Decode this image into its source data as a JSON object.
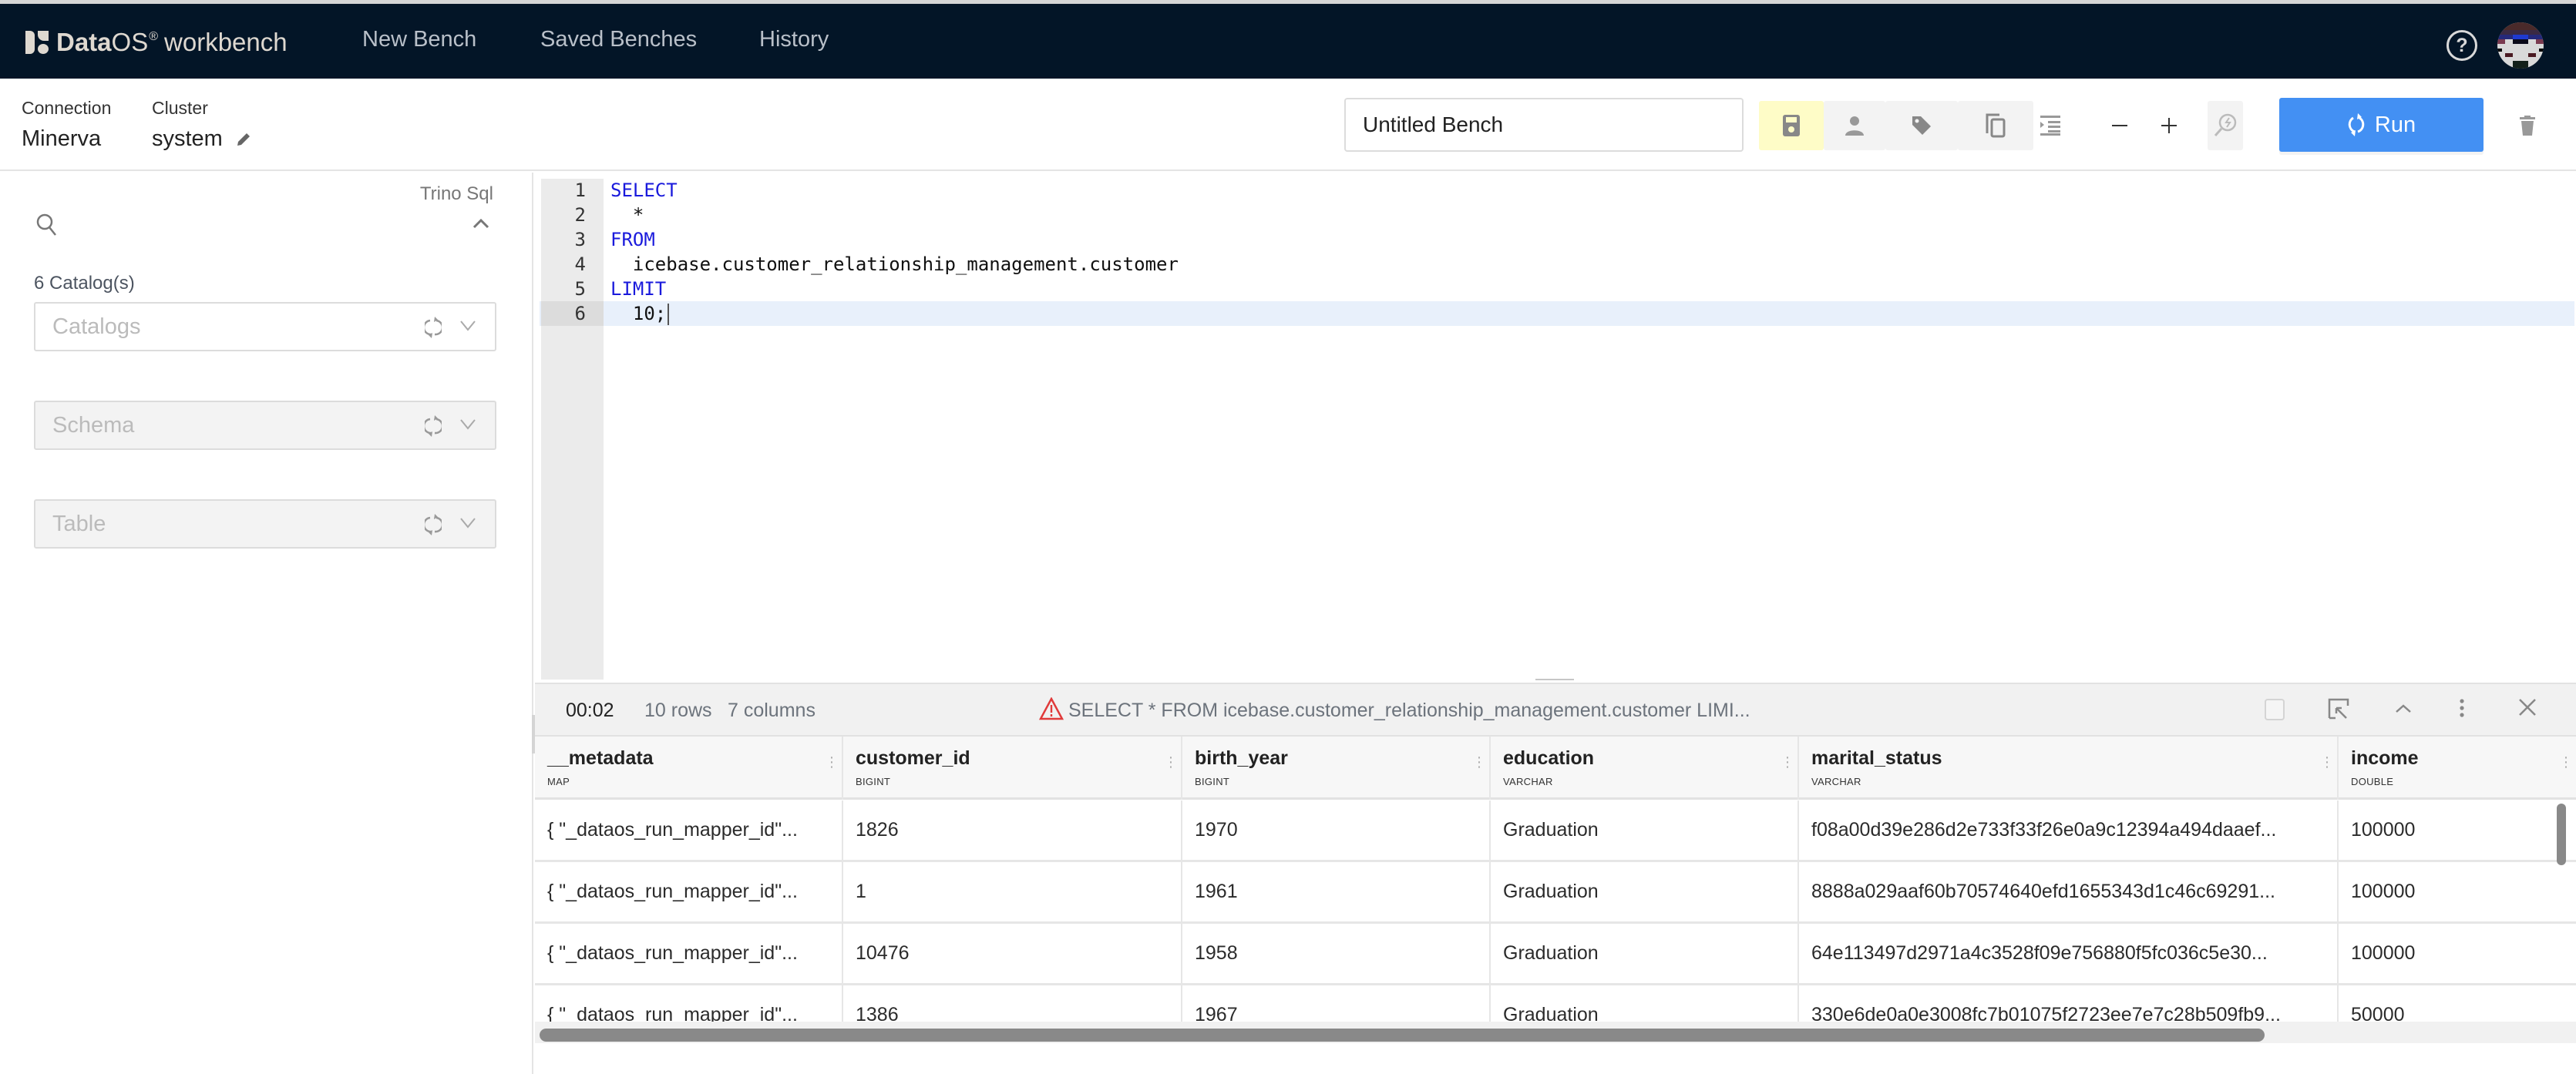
{
  "app": {
    "brand_bold": "Data",
    "brand_regular": "OS",
    "brand_reg_mark": "®",
    "brand_product": "workbench"
  },
  "nav": {
    "items": [
      {
        "label": "New Bench"
      },
      {
        "label": "Saved Benches"
      },
      {
        "label": "History"
      }
    ],
    "help_label": "?"
  },
  "connection": {
    "connection_label": "Connection",
    "connection_value": "Minerva",
    "cluster_label": "Cluster",
    "cluster_value": "system"
  },
  "toolbar": {
    "bench_name": "Untitled Bench",
    "bench_name_placeholder": "Untitled Bench",
    "icons": [
      "save-icon",
      "user-icon",
      "tag-icon",
      "copy-icon",
      "indent-icon",
      "zoom-out-icon",
      "zoom-in-icon",
      "analyze-icon",
      "delete-icon"
    ],
    "run_label": "Run",
    "colors": {
      "run": "#4390f3",
      "save_bg": "#fefcc7",
      "nav_bg": "#031527"
    }
  },
  "sidebar": {
    "language": "Trino Sql",
    "catalog_count": "6 Catalog(s)",
    "selects": [
      {
        "placeholder": "Catalogs",
        "disabled": false
      },
      {
        "placeholder": "Schema",
        "disabled": true
      },
      {
        "placeholder": "Table",
        "disabled": true
      }
    ]
  },
  "editor": {
    "lines": [
      {
        "num": "1",
        "text": "SELECT",
        "keyword": true
      },
      {
        "num": "2",
        "text": "  *",
        "keyword": false
      },
      {
        "num": "3",
        "text": "FROM",
        "keyword": true
      },
      {
        "num": "4",
        "text": "  icebase.customer_relationship_management.customer",
        "keyword": false
      },
      {
        "num": "5",
        "text": "LIMIT",
        "keyword": true
      },
      {
        "num": "6",
        "text": "  10;",
        "keyword": false
      }
    ],
    "active_line": 6
  },
  "results": {
    "elapsed": "00:02",
    "rows": "10 rows",
    "columns_count": "7 columns",
    "query_preview": "SELECT * FROM icebase.customer_relationship_management.customer LIMI...",
    "columns": [
      {
        "name": "__metadata",
        "type": "MAP"
      },
      {
        "name": "customer_id",
        "type": "BIGINT"
      },
      {
        "name": "birth_year",
        "type": "BIGINT"
      },
      {
        "name": "education",
        "type": "VARCHAR"
      },
      {
        "name": "marital_status",
        "type": "VARCHAR"
      },
      {
        "name": "income",
        "type": "DOUBLE"
      }
    ],
    "rows_data": [
      [
        "{ \"_dataos_run_mapper_id\"...",
        "1826",
        "1970",
        "Graduation",
        "f08a00d39e286d2e733f33f26e0a9c12394a494daaef...",
        "100000"
      ],
      [
        "{ \"_dataos_run_mapper_id\"...",
        "1",
        "1961",
        "Graduation",
        "8888a029aaf60b70574640efd1655343d1c46c69291...",
        "100000"
      ],
      [
        "{ \"_dataos_run_mapper_id\"...",
        "10476",
        "1958",
        "Graduation",
        "64e113497d2971a4c3528f09e756880f5fc036c5e30...",
        "100000"
      ],
      [
        "{ \"_dataos_run_mapper_id\"...",
        "1386",
        "1967",
        "Graduation",
        "330e6de0a0e3008fc7b01075f2723ee7e7c28b509fb9...",
        "50000"
      ]
    ]
  }
}
